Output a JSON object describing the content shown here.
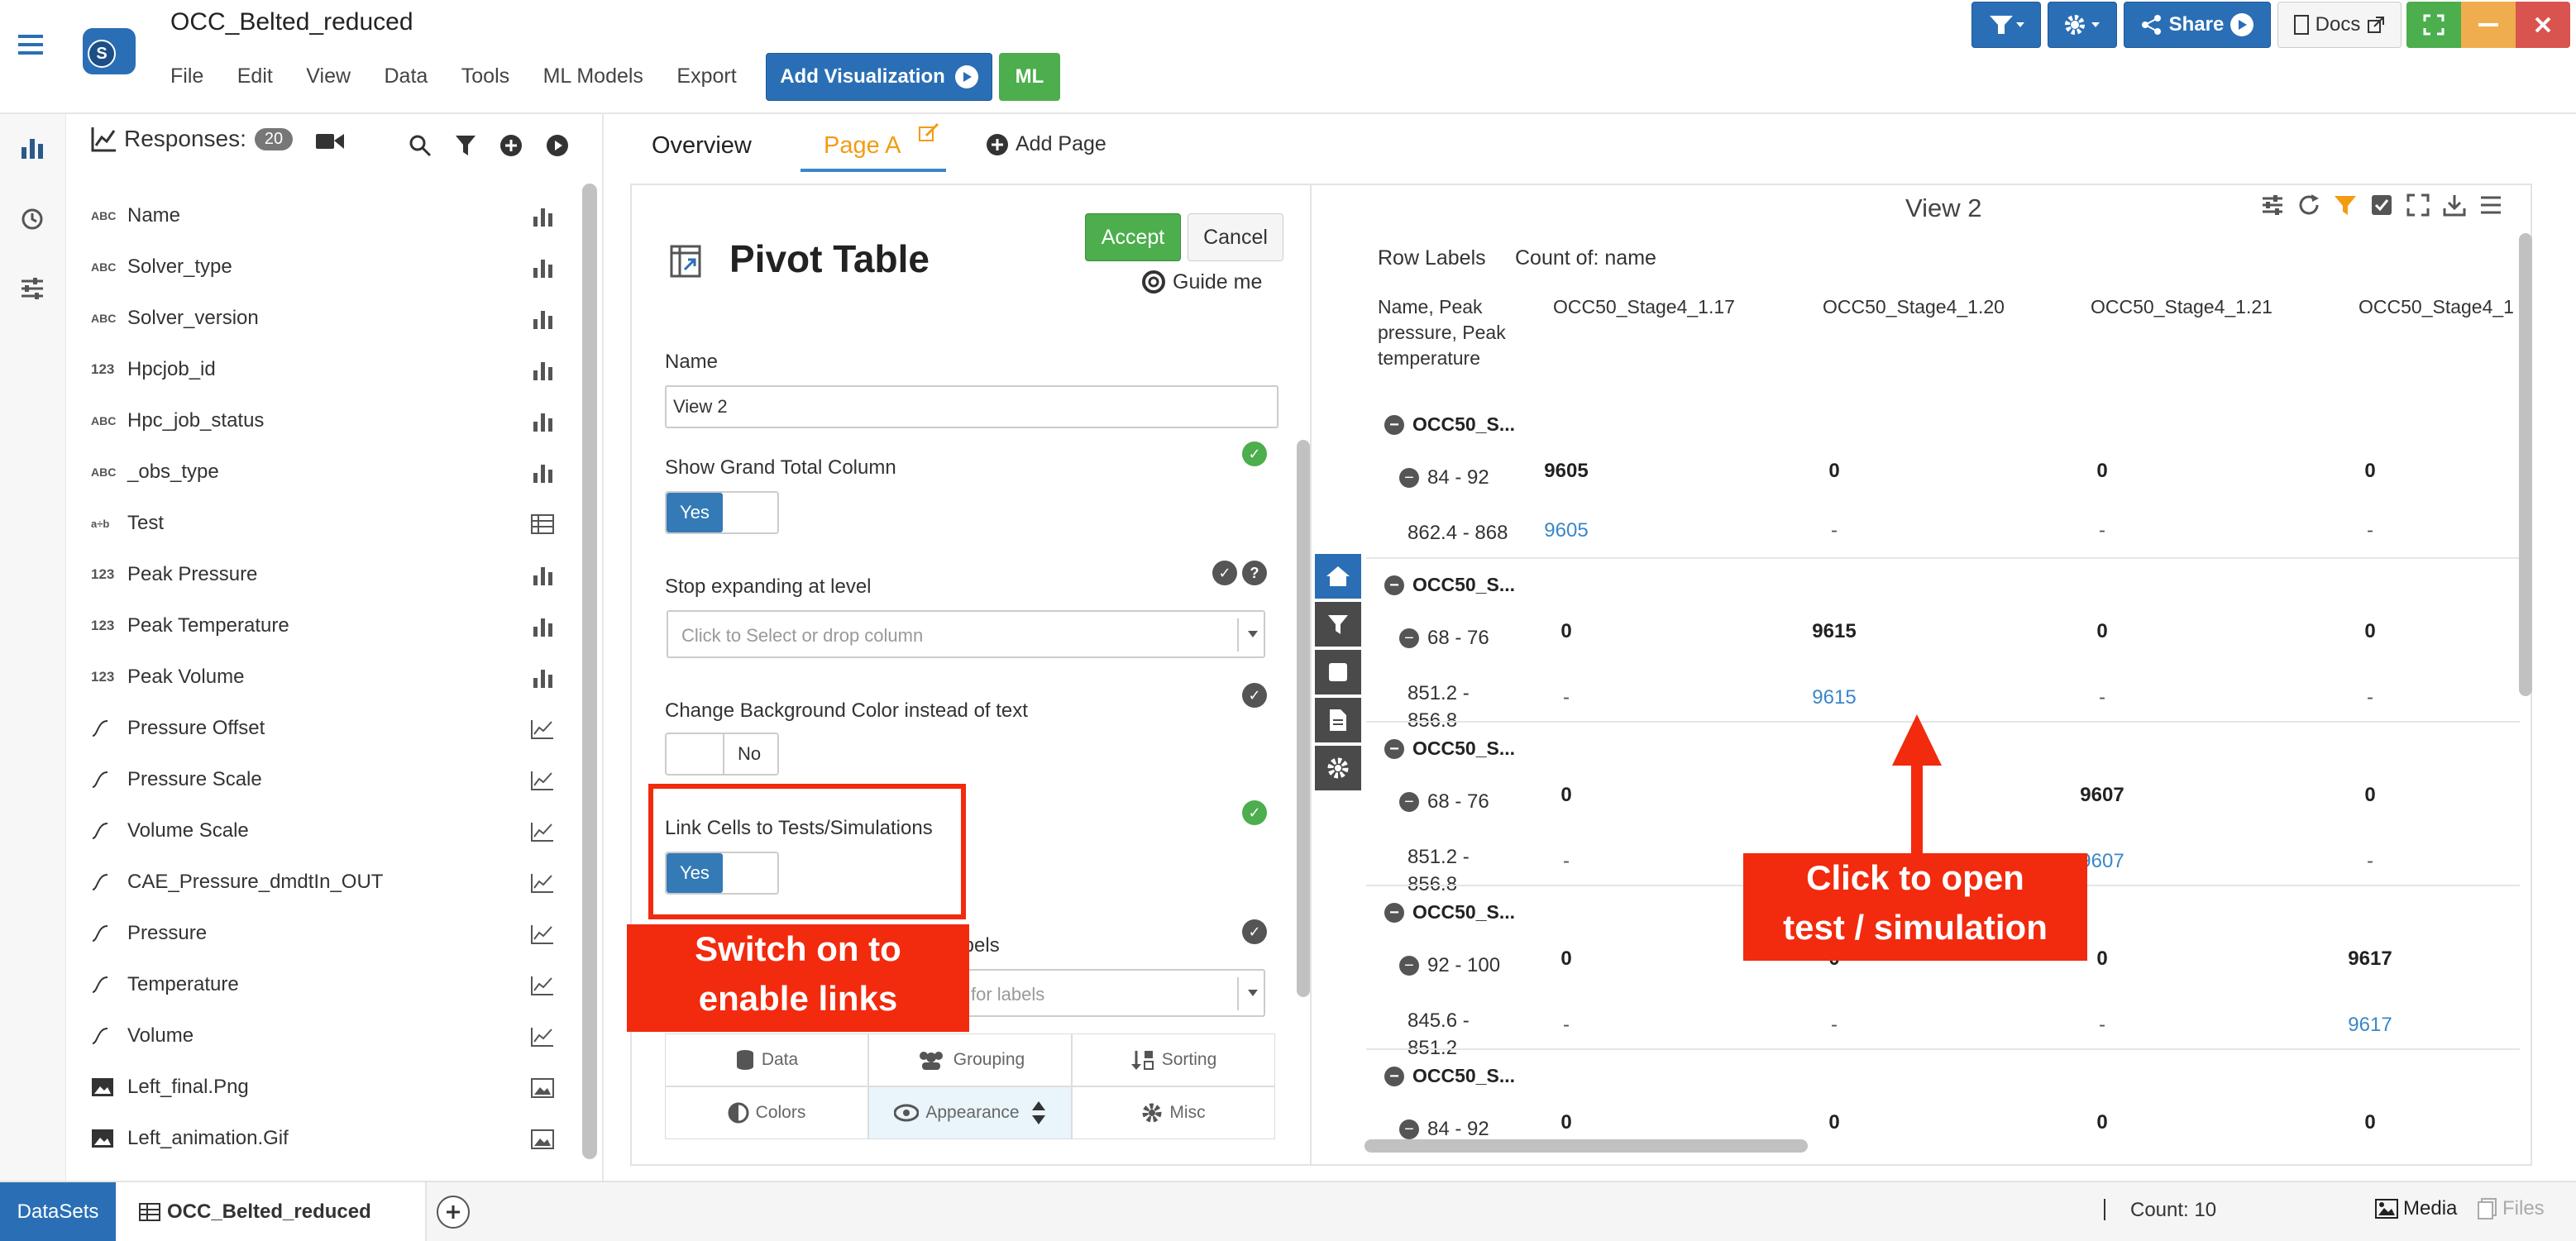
{
  "app": {
    "title": "OCC_Belted_reduced",
    "logo_letter": "S"
  },
  "menu": [
    "File",
    "Edit",
    "View",
    "Data",
    "Tools",
    "ML Models",
    "Export"
  ],
  "toolbar": {
    "add_viz": "Add Visualization",
    "ml": "ML",
    "share": "Share",
    "docs": "Docs"
  },
  "responses": {
    "label": "Responses:",
    "count": "20",
    "items": [
      {
        "type": "ABC",
        "name": "Name",
        "icon": "bar-chart-icon"
      },
      {
        "type": "ABC",
        "name": "Solver_type",
        "icon": "bar-chart-icon"
      },
      {
        "type": "ABC",
        "name": "Solver_version",
        "icon": "bar-chart-icon"
      },
      {
        "type": "123",
        "name": "Hpcjob_id",
        "icon": "bar-chart-icon"
      },
      {
        "type": "ABC",
        "name": "Hpc_job_status",
        "icon": "bar-chart-icon"
      },
      {
        "type": "ABC",
        "name": "_obs_type",
        "icon": "bar-chart-icon"
      },
      {
        "type": "a+b",
        "name": "Test",
        "icon": "table-icon"
      },
      {
        "type": "123",
        "name": "Peak Pressure",
        "icon": "bar-chart-icon"
      },
      {
        "type": "123",
        "name": "Peak Temperature",
        "icon": "bar-chart-icon"
      },
      {
        "type": "123",
        "name": "Peak Volume",
        "icon": "bar-chart-icon"
      },
      {
        "type": "curve",
        "name": "Pressure Offset",
        "icon": "line-chart-icon"
      },
      {
        "type": "curve",
        "name": "Pressure Scale",
        "icon": "line-chart-icon"
      },
      {
        "type": "curve",
        "name": "Volume Scale",
        "icon": "line-chart-icon"
      },
      {
        "type": "curve",
        "name": "CAE_Pressure_dmdtIn_OUT",
        "icon": "line-chart-icon"
      },
      {
        "type": "curve",
        "name": "Pressure",
        "icon": "line-chart-icon"
      },
      {
        "type": "curve",
        "name": "Temperature",
        "icon": "line-chart-icon"
      },
      {
        "type": "curve",
        "name": "Volume",
        "icon": "line-chart-icon"
      },
      {
        "type": "image",
        "name": "Left_final.Png",
        "icon": "image-icon"
      },
      {
        "type": "image",
        "name": "Left_animation.Gif",
        "icon": "image-icon"
      }
    ]
  },
  "tabs": {
    "overview": "Overview",
    "page_a": "Page A",
    "add_page": "Add Page"
  },
  "pivot": {
    "title": "Pivot Table",
    "accept": "Accept",
    "cancel": "Cancel",
    "guide": "Guide me",
    "name_label": "Name",
    "name_value": "View 2",
    "grand_total_label": "Show Grand Total Column",
    "grand_total_value": "Yes",
    "stop_label": "Stop expanding at level",
    "stop_placeholder": "Click to Select or drop column",
    "bgcolor_label": "Change Background Color instead of text",
    "bgcolor_value": "No",
    "link_label": "Link Cells to Tests/Simulations",
    "link_value": "Yes",
    "labels_fragment": "labels",
    "labels_placeholder_fragment": "for labels",
    "bottom_tabs": [
      "Data",
      "Grouping",
      "Sorting",
      "Colors",
      "Appearance",
      "Misc"
    ]
  },
  "view": {
    "title": "View 2",
    "row_labels": "Row Labels",
    "count_of": "Count of: name",
    "row_header": "Name, Peak pressure, Peak temperature",
    "columns": [
      "OCC50_Stage4_1.17",
      "OCC50_Stage4_1.20",
      "OCC50_Stage4_1.21",
      "OCC50_Stage4_1"
    ],
    "groups": [
      {
        "name": "OCC50_S...",
        "sub": "84 - 92",
        "sub2": "862.4 - 868",
        "vals": [
          "9605",
          "0",
          "0",
          "0"
        ],
        "links": [
          "9605",
          "-",
          "-",
          "-"
        ]
      },
      {
        "name": "OCC50_S...",
        "sub": "68 - 76",
        "sub2": "851.2 - 856.8",
        "vals": [
          "0",
          "9615",
          "0",
          "0"
        ],
        "links": [
          "-",
          "9615",
          "-",
          "-"
        ]
      },
      {
        "name": "OCC50_S...",
        "sub": "68 - 76",
        "sub2": "851.2 - 856.8",
        "vals": [
          "0",
          "",
          "9607",
          "0"
        ],
        "links": [
          "-",
          "",
          "9607",
          "-"
        ]
      },
      {
        "name": "OCC50_S...",
        "sub": "92 - 100",
        "sub2": "845.6 - 851.2",
        "vals": [
          "0",
          "0",
          "0",
          "9617"
        ],
        "links": [
          "-",
          "-",
          "-",
          "9617"
        ]
      },
      {
        "name": "OCC50_S...",
        "sub": "84 - 92",
        "vals": [
          "0",
          "0",
          "0",
          "0"
        ]
      }
    ]
  },
  "callouts": {
    "switch_on": "Switch on to enable links",
    "click_open": "Click to open test / simulation"
  },
  "footer": {
    "datasets": "DataSets",
    "tab": "OCC_Belted_reduced",
    "count": "Count: 10",
    "media": "Media",
    "files": "Files"
  },
  "colors": {
    "brand_blue": "#2a6fb5",
    "accent_orange": "#f39c12",
    "callout_red": "#f22a0e",
    "green": "#4cae4c"
  }
}
